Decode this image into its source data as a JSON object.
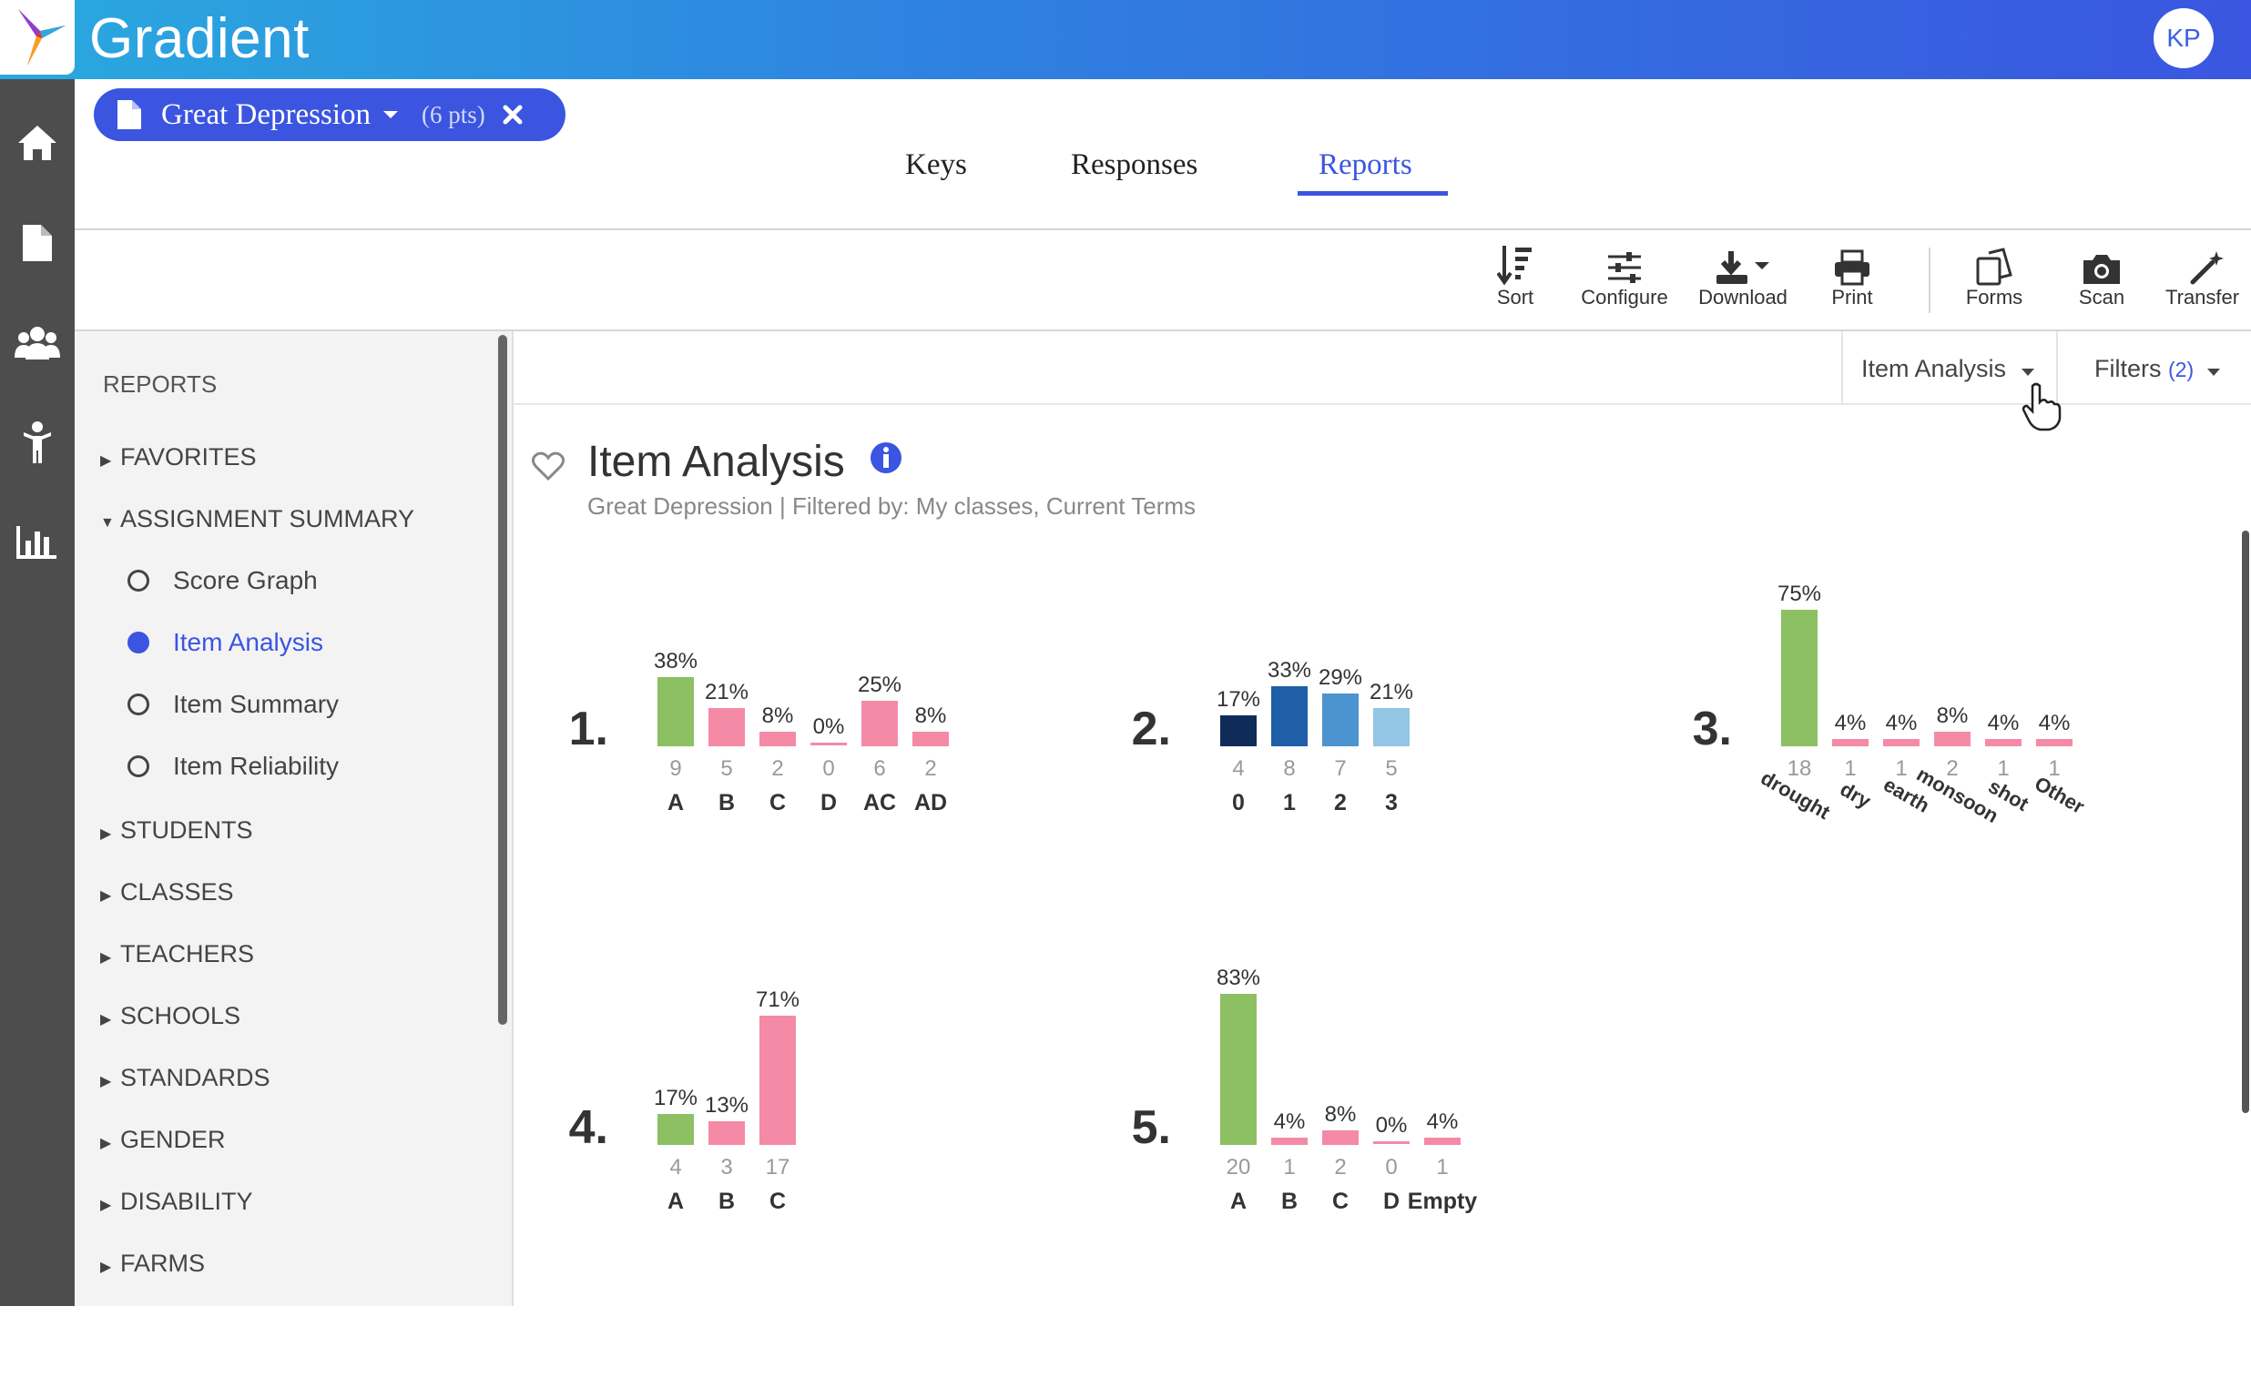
{
  "app": {
    "title": "Gradient",
    "avatar_initials": "KP",
    "accent_color": "#3b55e0"
  },
  "assignment": {
    "title": "Great Depression",
    "points": "(6 pts)"
  },
  "tabs": [
    {
      "label": "Keys"
    },
    {
      "label": "Responses"
    },
    {
      "label": "Reports",
      "active": true
    }
  ],
  "toolbar": [
    {
      "label": "Sort",
      "icon": "sort-icon"
    },
    {
      "label": "Configure",
      "icon": "sliders-icon"
    },
    {
      "label": "Download",
      "icon": "download-icon"
    },
    {
      "label": "Print",
      "icon": "print-icon"
    },
    {
      "label": "Forms",
      "icon": "forms-icon"
    },
    {
      "label": "Scan",
      "icon": "camera-icon"
    },
    {
      "label": "Transfer",
      "icon": "magic-wand-icon"
    }
  ],
  "sidebar": {
    "heading": "REPORTS",
    "sections": [
      {
        "label": "FAVORITES",
        "expanded": false
      },
      {
        "label": "ASSIGNMENT SUMMARY",
        "expanded": true
      },
      {
        "label": "STUDENTS",
        "expanded": false
      },
      {
        "label": "CLASSES",
        "expanded": false
      },
      {
        "label": "TEACHERS",
        "expanded": false
      },
      {
        "label": "SCHOOLS",
        "expanded": false
      },
      {
        "label": "STANDARDS",
        "expanded": false
      },
      {
        "label": "GENDER",
        "expanded": false
      },
      {
        "label": "DISABILITY",
        "expanded": false
      },
      {
        "label": "FARMS",
        "expanded": false
      }
    ],
    "summary_items": [
      {
        "label": "Score Graph",
        "selected": false
      },
      {
        "label": "Item Analysis",
        "selected": true
      },
      {
        "label": "Item Summary",
        "selected": false
      },
      {
        "label": "Item Reliability",
        "selected": false
      }
    ]
  },
  "report_controls": {
    "report_select": "Item Analysis",
    "filters_label": "Filters",
    "filters_count": "(2)"
  },
  "report": {
    "title": "Item Analysis",
    "subtitle": "Great Depression | Filtered by: My classes, Current Terms"
  },
  "colors": {
    "correct": "#8cc063",
    "incorrect": "#f48aa6",
    "navy": "#0f2c59",
    "blue": "#1f5fa8",
    "mid_blue": "#4b94cf",
    "light_blue": "#93c6e5"
  },
  "chart_data": [
    {
      "type": "bar",
      "item": "1.",
      "categories": [
        "A",
        "B",
        "C",
        "D",
        "AC",
        "AD"
      ],
      "percents": [
        38,
        21,
        8,
        0,
        25,
        8
      ],
      "counts": [
        9,
        5,
        2,
        0,
        6,
        2
      ],
      "correct": [
        true,
        false,
        false,
        false,
        false,
        false
      ]
    },
    {
      "type": "bar",
      "item": "2.",
      "categories": [
        "0",
        "1",
        "2",
        "3"
      ],
      "percents": [
        17,
        33,
        29,
        21
      ],
      "counts": [
        4,
        8,
        7,
        5
      ],
      "palette": [
        "navy",
        "blue",
        "mid_blue",
        "light_blue"
      ]
    },
    {
      "type": "bar",
      "item": "3.",
      "categories": [
        "drought",
        "dry",
        "earth",
        "monsoon",
        "shot",
        "Other"
      ],
      "percents": [
        75,
        4,
        4,
        8,
        4,
        4
      ],
      "counts": [
        18,
        1,
        1,
        2,
        1,
        1
      ],
      "correct": [
        true,
        false,
        false,
        false,
        false,
        false
      ],
      "rotated_labels": true
    },
    {
      "type": "bar",
      "item": "4.",
      "categories": [
        "A",
        "B",
        "C"
      ],
      "percents": [
        17,
        13,
        71
      ],
      "counts": [
        4,
        3,
        17
      ],
      "correct": [
        true,
        false,
        false
      ]
    },
    {
      "type": "bar",
      "item": "5.",
      "categories": [
        "A",
        "B",
        "C",
        "D",
        "Empty"
      ],
      "percents": [
        83,
        4,
        8,
        0,
        4
      ],
      "counts": [
        20,
        1,
        2,
        0,
        1
      ],
      "correct": [
        true,
        false,
        false,
        false,
        false
      ]
    }
  ]
}
